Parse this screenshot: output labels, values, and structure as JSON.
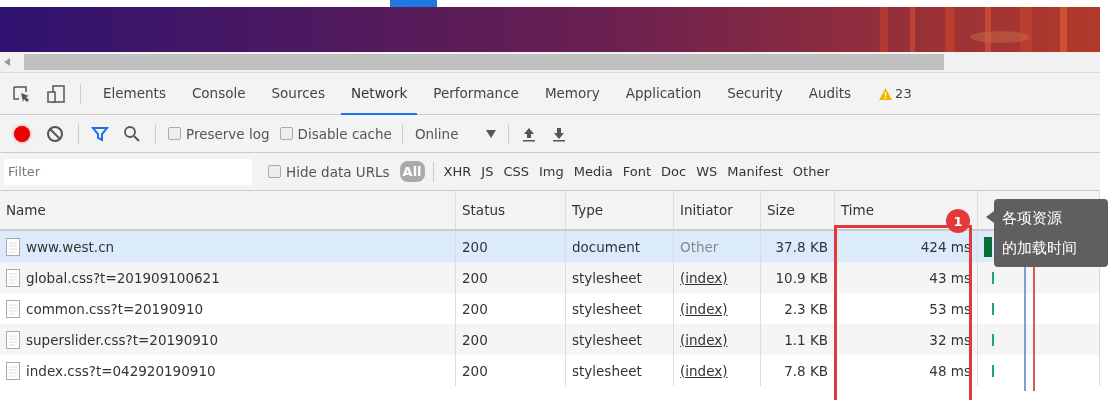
{
  "devtools_tabs": [
    {
      "label": "Elements",
      "selected": false
    },
    {
      "label": "Console",
      "selected": false
    },
    {
      "label": "Sources",
      "selected": false
    },
    {
      "label": "Network",
      "selected": true
    },
    {
      "label": "Performance",
      "selected": false
    },
    {
      "label": "Memory",
      "selected": false
    },
    {
      "label": "Application",
      "selected": false
    },
    {
      "label": "Security",
      "selected": false
    },
    {
      "label": "Audits",
      "selected": false
    }
  ],
  "warning_count": "23",
  "toolbar": {
    "preserve_log": {
      "label": "Preserve log",
      "checked": false
    },
    "disable_cache": {
      "label": "Disable cache",
      "checked": false
    },
    "throttling": "Online"
  },
  "filter_bar": {
    "placeholder": "Filter",
    "hide_data_urls": {
      "label": "Hide data URLs",
      "checked": false
    },
    "types": [
      {
        "label": "All",
        "selected": true
      },
      {
        "label": "XHR",
        "selected": false
      },
      {
        "label": "JS",
        "selected": false
      },
      {
        "label": "CSS",
        "selected": false
      },
      {
        "label": "Img",
        "selected": false
      },
      {
        "label": "Media",
        "selected": false
      },
      {
        "label": "Font",
        "selected": false
      },
      {
        "label": "Doc",
        "selected": false
      },
      {
        "label": "WS",
        "selected": false
      },
      {
        "label": "Manifest",
        "selected": false
      },
      {
        "label": "Other",
        "selected": false
      }
    ]
  },
  "table": {
    "columns": [
      "Name",
      "Status",
      "Type",
      "Initiator",
      "Size",
      "Time"
    ],
    "rows": [
      {
        "name": "www.west.cn",
        "status": "200",
        "type": "document",
        "initiator": "Other",
        "initiator_link": false,
        "size": "37.8 KB",
        "time": "424 ms",
        "selected": true
      },
      {
        "name": "global.css?t=201909100621",
        "status": "200",
        "type": "stylesheet",
        "initiator": "(index)",
        "initiator_link": true,
        "size": "10.9 KB",
        "time": "43 ms",
        "selected": false
      },
      {
        "name": "common.css?t=20190910",
        "status": "200",
        "type": "stylesheet",
        "initiator": "(index)",
        "initiator_link": true,
        "size": "2.3 KB",
        "time": "53 ms",
        "selected": false
      },
      {
        "name": "superslider.css?t=20190910",
        "status": "200",
        "type": "stylesheet",
        "initiator": "(index)",
        "initiator_link": true,
        "size": "1.1 KB",
        "time": "32 ms",
        "selected": false
      },
      {
        "name": "index.css?t=042920190910",
        "status": "200",
        "type": "stylesheet",
        "initiator": "(index)",
        "initiator_link": true,
        "size": "7.8 KB",
        "time": "48 ms",
        "selected": false
      }
    ]
  },
  "annotation": {
    "badge": "1",
    "tooltip_lines": [
      "各项资源",
      "的加载时间"
    ]
  }
}
